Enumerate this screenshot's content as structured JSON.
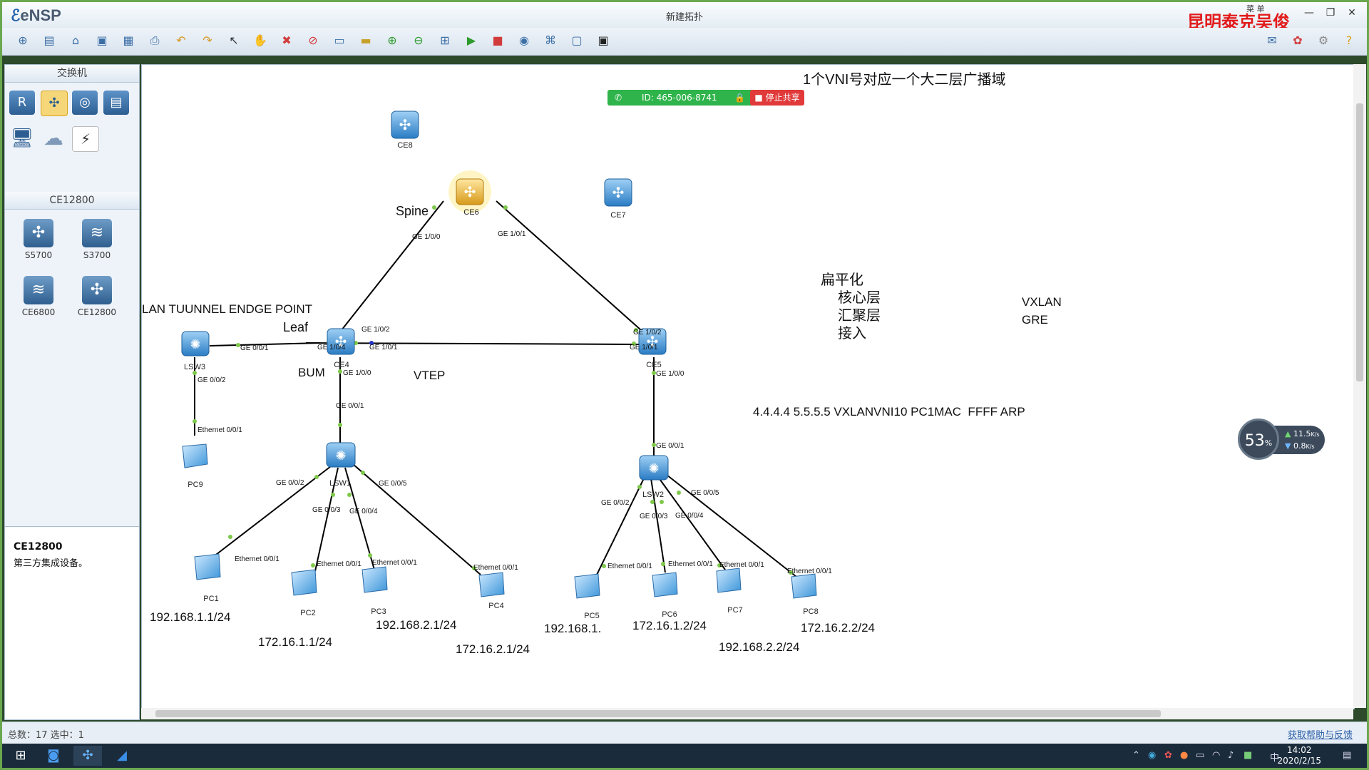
{
  "window": {
    "title": "新建拓扑",
    "app_name": "eNSP",
    "brand": "昆明泰克吴俊",
    "menu_label": "菜 单"
  },
  "toolbar": {
    "icons": [
      "new-topology",
      "open",
      "open-example",
      "save",
      "save-as",
      "print",
      "undo",
      "redo",
      "select",
      "pan",
      "delete",
      "delete-link",
      "text",
      "shape",
      "zoom-in",
      "zoom-out",
      "fit",
      "start",
      "stop",
      "capture",
      "topology-view",
      "grid",
      "cli",
      "terminal"
    ],
    "right_icons": [
      "chat",
      "huawei",
      "settings",
      "help"
    ]
  },
  "sidebar": {
    "header1": "交换机",
    "header2": "CE12800",
    "devices": [
      {
        "label": "S5700"
      },
      {
        "label": "S3700"
      },
      {
        "label": "CE6800"
      },
      {
        "label": "CE12800"
      }
    ],
    "info_title": "CE12800",
    "info_desc": "第三方集成设备。"
  },
  "share": {
    "id_text": "ID: 465-006-8741",
    "stop_label": "停止共享"
  },
  "canvas": {
    "annotations": {
      "vni": "1个VNI号对应一个大二层广播域",
      "spine": "Spine",
      "vtep_long": "LAN TUUNNEL ENDGE POINT",
      "leaf": "Leaf",
      "bum": "BUM",
      "vtep": "VTEP",
      "flat": "扁平化",
      "core": "核心层",
      "agg": "汇聚层",
      "access": "接入",
      "vxlan": "VXLAN",
      "gre": "GRE",
      "flow": "4.4.4.4 5.5.5.5 VXLANVNI10 PC1MAC  FFFF ARP"
    },
    "nodes": {
      "ce8": "CE8",
      "ce6": "CE6",
      "ce7": "CE7",
      "ce4": "CE4",
      "ce5": "CE5",
      "lsw3": "LSW3",
      "lsw1": "LSW1",
      "lsw2": "LSW2",
      "pc1": "PC1",
      "pc2": "PC2",
      "pc3": "PC3",
      "pc4": "PC4",
      "pc5": "PC5",
      "pc6": "PC6",
      "pc7": "PC7",
      "pc8": "PC8",
      "pc9": "PC9"
    },
    "ports": {
      "ce6_g100": "GE 1/0/0",
      "ce6_g101": "GE 1/0/1",
      "ce4_g102": "GE 1/0/2",
      "ce4_g104": "GE 1/0/4",
      "ce4_g101": "GE 1/0/1",
      "ce4_g100": "GE 1/0/0",
      "ce5_g102": "GE 1/0/2",
      "ce5_g101": "GE 1/0/1",
      "ce5_g100": "GE 1/0/0",
      "lsw3_g001": "GE 0/0/1",
      "lsw3_g002": "GE 0/0/2",
      "pc9_eth": "Ethernet 0/0/1",
      "lsw1_g001": "GE 0/0/1",
      "lsw1_g002": "GE 0/0/2",
      "lsw1_g003": "GE 0/0/3",
      "lsw1_g004": "GE 0/0/4",
      "lsw1_g005": "GE 0/0/5",
      "lsw2_g001": "GE 0/0/1",
      "lsw2_g002": "GE 0/0/2",
      "lsw2_g003": "GE 0/0/3",
      "lsw2_g004": "GE 0/0/4",
      "lsw2_g005": "GE 0/0/5",
      "pc1_eth": "Ethernet 0/0/1",
      "pc2_eth": "Ethernet 0/0/1",
      "pc3_eth": "Ethernet 0/0/1",
      "pc4_eth": "Ethernet 0/0/1",
      "pc5_eth": "Ethernet 0/0/1",
      "pc6_eth": "Ethernet 0/0/1",
      "pc7_eth": "Ethernet 0/0/1",
      "pc8_eth": "Ethernet 0/0/1"
    },
    "ips": {
      "pc1": "192.168.1.1/24",
      "pc2": "172.16.1.1/24",
      "pc3": "192.168.2.1/24",
      "pc4": "172.16.2.1/24",
      "pc5": "192.168.1.",
      "pc6": "172.16.1.2/24",
      "pc7": "192.168.2.2/24",
      "pc8": "172.16.2.2/24"
    }
  },
  "gauge": {
    "percent": "53",
    "percent_unit": "%",
    "up": "11.5",
    "down": "0.8",
    "rate_unit": "K/s"
  },
  "status": {
    "left": "总数：17  选中：1",
    "right": "获取帮助与反馈"
  },
  "taskbar": {
    "time": "14:02",
    "date": "2020/2/15",
    "ime": "中"
  },
  "colors": {
    "link": "#000000",
    "port_dot": "#7ec84a",
    "switch": "#3d8fd6",
    "accent_red": "#e21b1b"
  }
}
